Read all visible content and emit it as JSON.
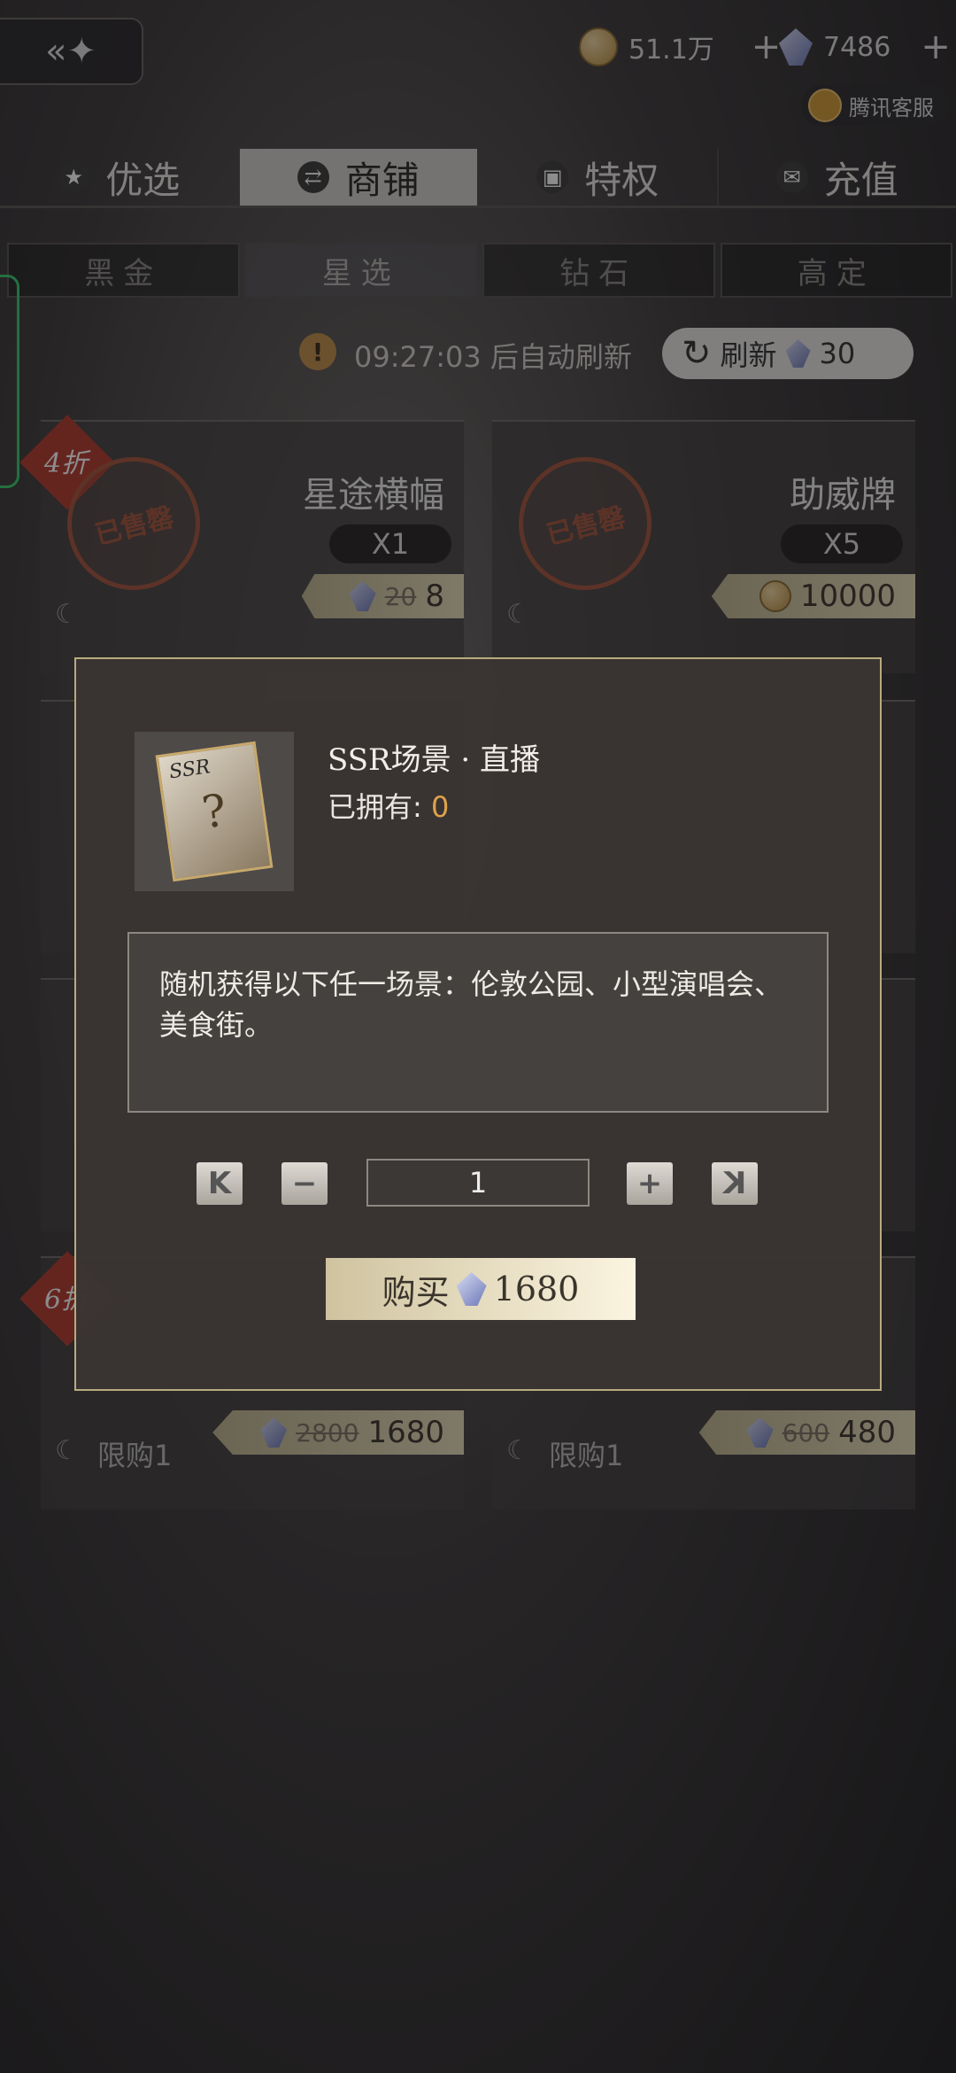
{
  "header": {
    "back_icon": "back-arrow-icon",
    "back_glyph": "«✦",
    "coin_amount": "51.1万",
    "coin_plus": "+",
    "gem_amount": "7486",
    "gem_plus": "+",
    "service_label": "腾讯客服"
  },
  "main_tabs": [
    {
      "label": "优选",
      "icon": "★",
      "active": false
    },
    {
      "label": "商铺",
      "icon": "⇄",
      "active": true
    },
    {
      "label": "特权",
      "icon": "▣",
      "active": false
    },
    {
      "label": "充值",
      "icon": "✉",
      "active": false
    }
  ],
  "sub_tabs": [
    {
      "label": "黑金",
      "active": false
    },
    {
      "label": "星选",
      "active": true
    },
    {
      "label": "钻石",
      "active": false
    },
    {
      "label": "高定",
      "active": false
    }
  ],
  "refresh": {
    "alert_glyph": "!",
    "timer_text": "09:27:03 后自动刷新",
    "icon_glyph": "↻",
    "label": "刷新",
    "cost": "30"
  },
  "cards": [
    {
      "discount": "4折",
      "title": "星途横幅",
      "qty": "X1",
      "price_old": "20",
      "price": "8",
      "currency": "gem",
      "sold": "已售罄"
    },
    {
      "title": "助威牌",
      "qty": "X5",
      "price": "10000",
      "currency": "coin",
      "sold": "已售罄"
    },
    {
      "discount": "6折",
      "limit": "限购1",
      "price_old": "2800",
      "price": "1680",
      "currency": "gem"
    },
    {
      "limit": "限购1",
      "price_old": "600",
      "price": "480",
      "currency": "gem"
    }
  ],
  "dialog": {
    "item_name": "SSR场景 · 直播",
    "card_badge": "SSR",
    "card_glyph": "?",
    "owned_label": "已拥有:",
    "owned_value": "0",
    "description": "随机获得以下任一场景：伦敦公园、小型演唱会、美食街。",
    "quantity": "1",
    "btn_first": "K",
    "btn_minus": "−",
    "btn_plus": "+",
    "btn_last": "K",
    "buy_label": "购买",
    "buy_price": "1680"
  },
  "colors": {
    "accent_gold": "#e0a24a",
    "discount_red": "#b43a2c",
    "stamp": "#a5553d"
  }
}
